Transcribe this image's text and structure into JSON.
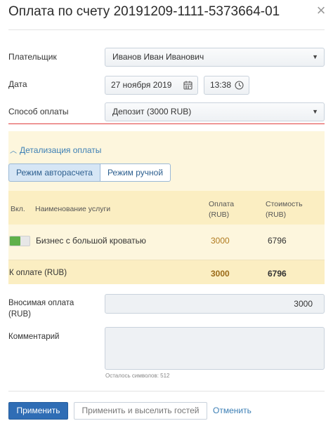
{
  "dialog": {
    "title": "Оплата по счету 20191209-1111-5373664-01",
    "close_glyph": "×"
  },
  "form": {
    "payer_label": "Плательщик",
    "payer_value": "Иванов Иван Иванович",
    "date_label": "Дата",
    "date_value": "27 ноября 2019",
    "time_value": "13:38",
    "method_label": "Способ оплаты",
    "method_value": "Депозит (3000 RUB)"
  },
  "details": {
    "toggle_label": "Детализация оплаты",
    "mode_auto": "Режим авторасчета",
    "mode_manual": "Режим ручной",
    "active_mode": "auto",
    "columns": {
      "enabled": "Вкл.",
      "service": "Наименование услуги",
      "payment": [
        "Оплата",
        "(RUB)"
      ],
      "cost": [
        "Стоимость",
        "(RUB)"
      ]
    },
    "rows": [
      {
        "enabled": true,
        "service": "Бизнес с большой кроватью",
        "payment": "3000",
        "cost": "6796"
      }
    ],
    "total": {
      "label": "К оплате (RUB)",
      "payment": "3000",
      "cost": "6796"
    }
  },
  "deposit": {
    "label_line1": "Вносимая оплата",
    "label_line2": "(RUB)",
    "value": "3000"
  },
  "comment": {
    "label": "Комментарий",
    "value": "",
    "hint": "Осталось символов: 512"
  },
  "footer": {
    "apply": "Применить",
    "apply_and_checkin": "Применить и выселить гостей",
    "cancel": "Отменить"
  },
  "colors": {
    "accent": "#2f6db5",
    "link": "#3c7fb5",
    "error_line": "#e04040",
    "detail_bg": "#fdf6dd",
    "toggle_on": "#5fb14a",
    "payment_amount": "#b07a1e"
  },
  "icons": {
    "close": "close-icon",
    "dropdown": "caret-down-icon",
    "calendar": "calendar-icon",
    "clock": "clock-icon",
    "collapse": "chevron-up-icon"
  }
}
